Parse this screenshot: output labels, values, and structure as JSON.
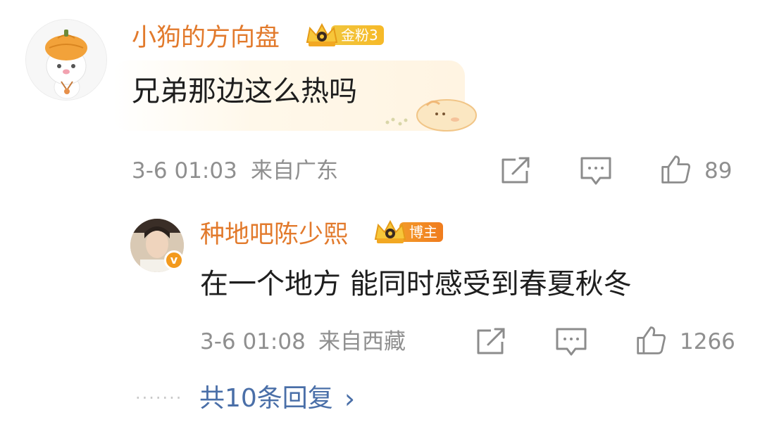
{
  "comment": {
    "username": "小狗的方向盘",
    "badge_label": "金粉3",
    "text": "兄弟那边这么热吗",
    "timestamp": "3-6 01:03",
    "location": "来自广东",
    "likes": "89"
  },
  "reply": {
    "username": "种地吧陈少熙",
    "badge_label": "博主",
    "verified_mark": "v",
    "text": "在一个地方 能同时感受到春夏秋冬",
    "timestamp": "3-6 01:08",
    "location": "来自西藏",
    "likes": "1266"
  },
  "more_replies": {
    "dots": "·······",
    "label": "共10条回复",
    "chevron": "›"
  },
  "colors": {
    "username": "#e27a2c",
    "meta": "#8f8f8f",
    "link": "#4a6fa8",
    "badge_gold": "#f1c63d",
    "badge_orange": "#f07c1e"
  },
  "icons": [
    "share-icon",
    "comment-icon",
    "like-icon",
    "crown-icon",
    "pumpkin-cat-avatar",
    "verified-v-icon",
    "bun-sticker"
  ]
}
